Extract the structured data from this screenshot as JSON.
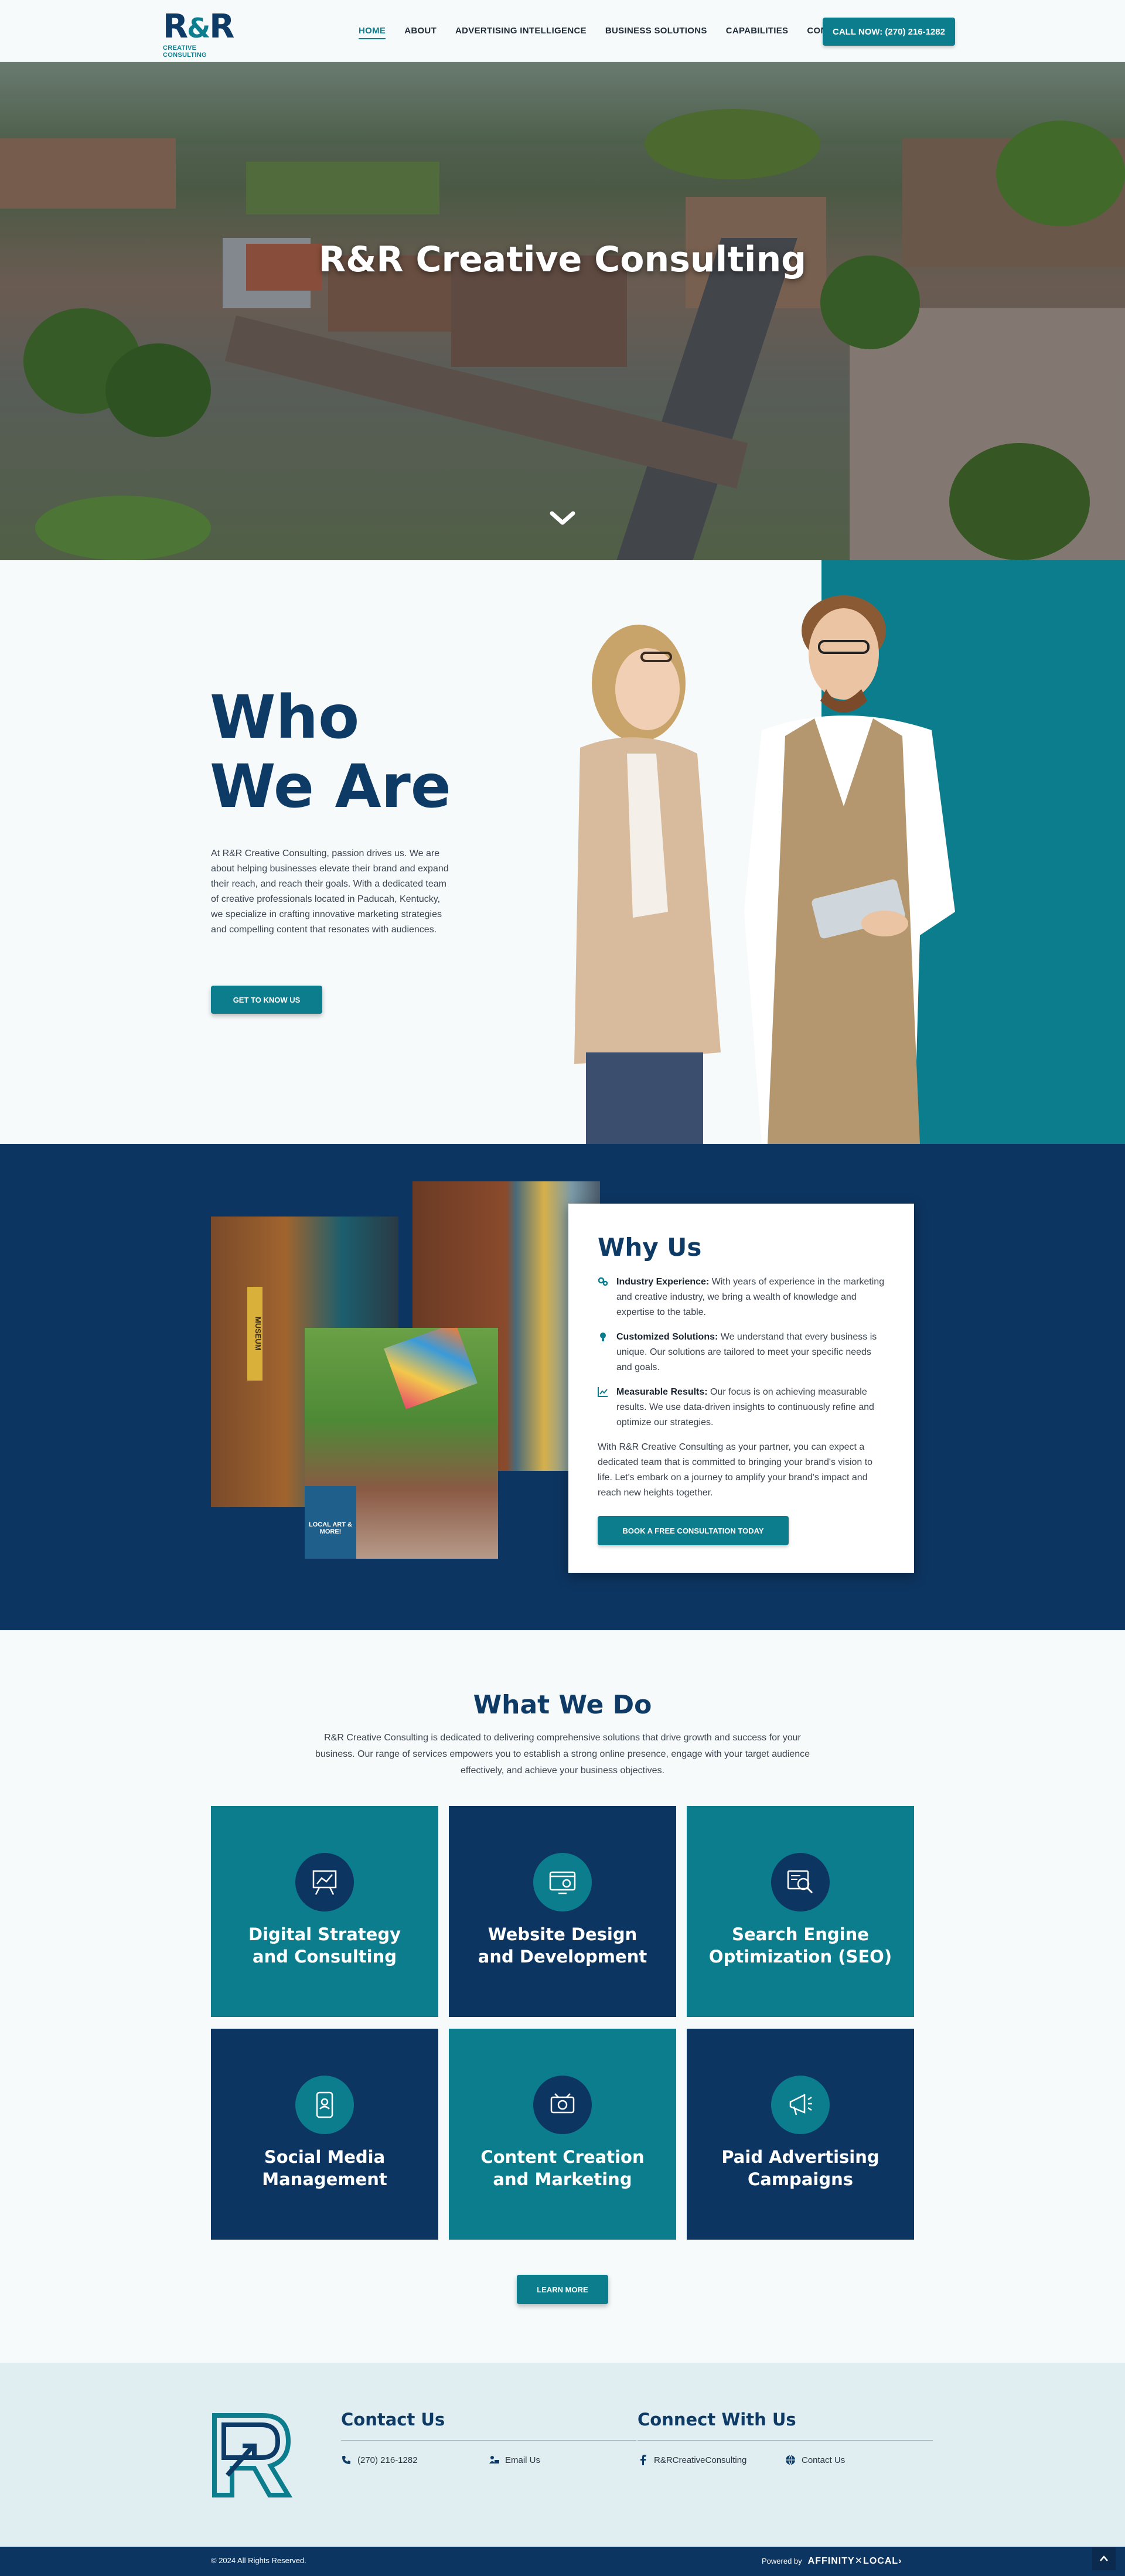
{
  "header": {
    "logo_text": "R&R",
    "logo_sub": "CREATIVE CONSULTING",
    "nav": [
      "HOME",
      "ABOUT",
      "ADVERTISING INTELLIGENCE",
      "BUSINESS SOLUTIONS",
      "CAPABILITIES",
      "CONTACT"
    ],
    "call_label": "CALL NOW: (270) 216-1282"
  },
  "hero": {
    "title": "R&R Creative Consulting",
    "scroll_icon": "chevron-down-icon"
  },
  "who": {
    "title_line1": "Who",
    "title_line2": "We Are",
    "text": "At R&R Creative Consulting, passion drives us. We are about helping businesses elevate their brand and expand their reach, and reach their goals. With a dedicated team of creative professionals located in Paducah, Kentucky, we specialize in crafting innovative marketing strategies and compelling content that resonates with audiences.",
    "button": "GET TO KNOW US"
  },
  "why": {
    "title": "Why Us",
    "items": [
      {
        "icon": "gears-icon",
        "label": "Industry Experience:",
        "text": " With years of experience in the marketing and creative industry, we bring a wealth of knowledge and expertise to the table."
      },
      {
        "icon": "lightbulb-icon",
        "label": "Customized Solutions:",
        "text": " We understand that every business is unique. Our solutions are tailored to meet your specific needs and goals."
      },
      {
        "icon": "chart-line-icon",
        "label": "Measurable Results:",
        "text": " Our focus is on achieving measurable results. We use data-driven insights to continuously refine and optimize our strategies."
      }
    ],
    "paragraph": "With R&R Creative Consulting as your partner, you can expect a dedicated team that is committed to bringing your brand's vision to life. Let's embark on a journey to amplify your brand's impact and reach new heights together.",
    "button": "BOOK A FREE CONSULTATION TODAY",
    "collage_signs": {
      "museum": "MUSEUM",
      "local_art": "LOCAL ART & MORE!"
    }
  },
  "what": {
    "title": "What We Do",
    "text": "R&R Creative Consulting is dedicated to delivering comprehensive solutions that drive growth and success for your business. Our range of services empowers you to establish a strong online presence, engage with your target audience effectively, and achieve your business objectives.",
    "services": [
      {
        "label": "Digital Strategy and Consulting",
        "icon": "strategy-board-icon"
      },
      {
        "label": "Website Design and Development",
        "icon": "web-design-icon"
      },
      {
        "label": "Search Engine Optimization (SEO)",
        "icon": "seo-search-icon"
      },
      {
        "label": "Social Media Management",
        "icon": "social-media-icon"
      },
      {
        "label": "Content Creation and Marketing",
        "icon": "content-creation-icon"
      },
      {
        "label": "Paid Advertising Campaigns",
        "icon": "megaphone-icon"
      }
    ],
    "button": "LEARN MORE"
  },
  "footer": {
    "contact_title": "Contact Us",
    "phone": "(270) 216-1282",
    "email": "Email Us",
    "connect_title": "Connect With Us",
    "facebook": "R&RCreativeConsulting",
    "contact_link": "Contact Us",
    "copyright": "© 2024 All Rights Reserved.",
    "powered_by": "Powered by",
    "powered_brand": "AFFINITY✕LOCAL›"
  },
  "colors": {
    "navy": "#0d3561",
    "teal": "#0b7d8c",
    "title": "#0e3a66"
  }
}
